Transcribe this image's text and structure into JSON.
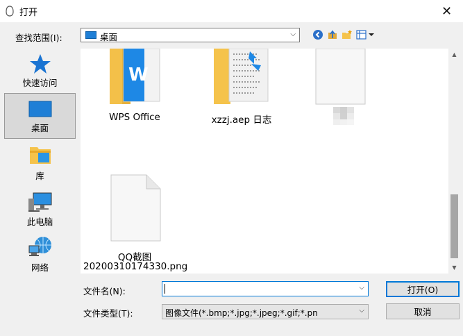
{
  "window": {
    "title": "打开",
    "close_glyph": "✕"
  },
  "lookin": {
    "label": "查找范围(I):",
    "value": "桌面",
    "icon": "desktop-icon",
    "chevron": "⌵"
  },
  "toolbar": {
    "icons": [
      "back-icon",
      "up-folder-icon",
      "new-folder-icon",
      "view-menu-icon"
    ]
  },
  "places": [
    {
      "label": "快速访问",
      "icon": "star-icon",
      "selected": false
    },
    {
      "label": "桌面",
      "icon": "desktop-icon",
      "selected": true
    },
    {
      "label": "库",
      "icon": "library-icon",
      "selected": false
    },
    {
      "label": "此电脑",
      "icon": "computer-icon",
      "selected": false
    },
    {
      "label": "网络",
      "icon": "network-icon",
      "selected": false
    }
  ],
  "files": [
    {
      "name": "WPS Office",
      "icon": "wps-folder-icon"
    },
    {
      "name": "xzzj.aep 日志",
      "icon": "log-folder-icon"
    },
    {
      "name": "",
      "icon": "blank-file-icon"
    },
    {
      "name_line1": "QQ截图",
      "name_line2": "20200310174330.png",
      "icon": "png-file-icon"
    }
  ],
  "scroll": {
    "up": "▲",
    "down": "▼"
  },
  "filename": {
    "label": "文件名(N):",
    "value": "",
    "chevron": "⌵"
  },
  "filetype": {
    "label": "文件类型(T):",
    "value": "图像文件(*.bmp;*.jpg;*.jpeg;*.gif;*.pn",
    "chevron": "⌵"
  },
  "buttons": {
    "open": "打开(O)",
    "cancel": "取消"
  },
  "colors": {
    "accent": "#0078d7",
    "folder": "#f5c34b",
    "desktop": "#1f7fd6"
  }
}
